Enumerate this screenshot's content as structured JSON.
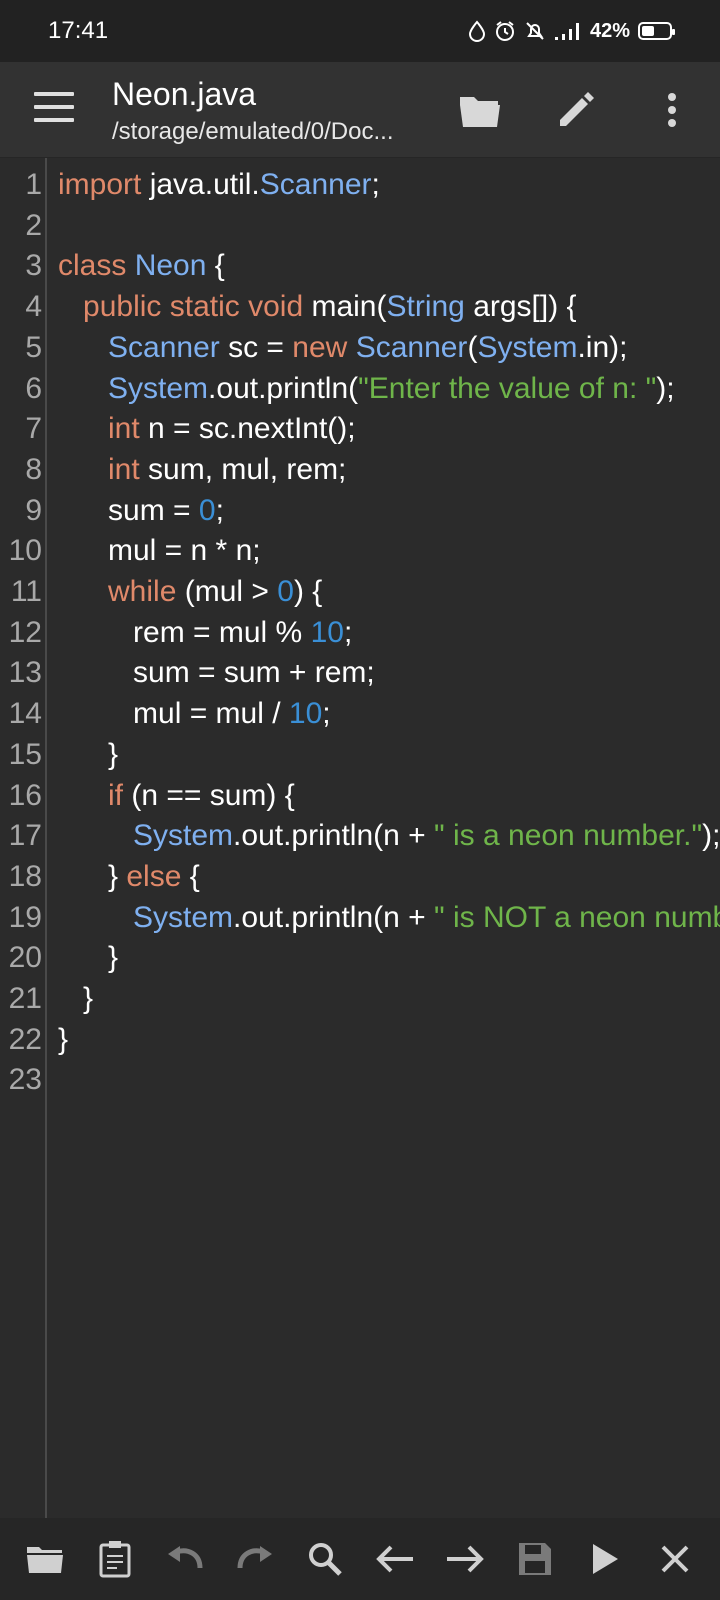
{
  "status_bar": {
    "time": "17:41",
    "battery_percent": "42%",
    "icons": [
      "drop-icon",
      "alarm-icon",
      "notifications-off-icon",
      "signal-icon",
      "battery-icon"
    ]
  },
  "app_bar": {
    "title": "Neon.java",
    "subtitle": "/storage/emulated/0/Doc...",
    "icons": [
      "menu-icon",
      "folder-open-icon",
      "edit-icon",
      "more-vert-icon"
    ]
  },
  "editor": {
    "colors": {
      "keyword": "#e0896a",
      "type": "#7fb0f0",
      "number": "#3a8fd6",
      "string": "#6fb54a",
      "text": "#ffffff"
    },
    "lines": [
      {
        "n": "1",
        "tokens": [
          [
            "kw",
            "import"
          ],
          [
            "tx",
            " java.util."
          ],
          [
            "ty",
            "Scanner"
          ],
          [
            "tx",
            ";"
          ]
        ]
      },
      {
        "n": "2",
        "tokens": []
      },
      {
        "n": "3",
        "tokens": [
          [
            "kw",
            "class"
          ],
          [
            "tx",
            " "
          ],
          [
            "ty",
            "Neon"
          ],
          [
            "tx",
            " {"
          ]
        ]
      },
      {
        "n": "4",
        "tokens": [
          [
            "tx",
            "   "
          ],
          [
            "kw",
            "public static void"
          ],
          [
            "tx",
            " main("
          ],
          [
            "ty",
            "String"
          ],
          [
            "tx",
            " args[]) {"
          ]
        ]
      },
      {
        "n": "5",
        "tokens": [
          [
            "tx",
            "      "
          ],
          [
            "ty",
            "Scanner"
          ],
          [
            "tx",
            " sc = "
          ],
          [
            "kw",
            "new"
          ],
          [
            "tx",
            " "
          ],
          [
            "ty",
            "Scanner"
          ],
          [
            "tx",
            "("
          ],
          [
            "ty",
            "System"
          ],
          [
            "tx",
            ".in);"
          ]
        ]
      },
      {
        "n": "6",
        "tokens": [
          [
            "tx",
            "      "
          ],
          [
            "ty",
            "System"
          ],
          [
            "tx",
            ".out.println("
          ],
          [
            "str",
            "\"Enter the value of n: \""
          ],
          [
            "tx",
            ");"
          ]
        ]
      },
      {
        "n": "7",
        "tokens": [
          [
            "tx",
            "      "
          ],
          [
            "kw",
            "int"
          ],
          [
            "tx",
            " n = sc.nextInt();"
          ]
        ]
      },
      {
        "n": "8",
        "tokens": [
          [
            "tx",
            "      "
          ],
          [
            "kw",
            "int"
          ],
          [
            "tx",
            " sum, mul, rem;"
          ]
        ]
      },
      {
        "n": "9",
        "tokens": [
          [
            "tx",
            "      sum = "
          ],
          [
            "num",
            "0"
          ],
          [
            "tx",
            ";"
          ]
        ]
      },
      {
        "n": "10",
        "tokens": [
          [
            "tx",
            "      mul = n * n;"
          ]
        ]
      },
      {
        "n": "11",
        "tokens": [
          [
            "tx",
            "      "
          ],
          [
            "kw",
            "while"
          ],
          [
            "tx",
            " (mul > "
          ],
          [
            "num",
            "0"
          ],
          [
            "tx",
            ") {"
          ]
        ]
      },
      {
        "n": "12",
        "tokens": [
          [
            "tx",
            "         rem = mul % "
          ],
          [
            "num",
            "10"
          ],
          [
            "tx",
            ";"
          ]
        ]
      },
      {
        "n": "13",
        "tokens": [
          [
            "tx",
            "         sum = sum + rem;"
          ]
        ]
      },
      {
        "n": "14",
        "tokens": [
          [
            "tx",
            "         mul = mul / "
          ],
          [
            "num",
            "10"
          ],
          [
            "tx",
            ";"
          ]
        ]
      },
      {
        "n": "15",
        "tokens": [
          [
            "tx",
            "      }"
          ]
        ]
      },
      {
        "n": "16",
        "tokens": [
          [
            "tx",
            "      "
          ],
          [
            "kw",
            "if"
          ],
          [
            "tx",
            " (n == sum) {"
          ]
        ]
      },
      {
        "n": "17",
        "tokens": [
          [
            "tx",
            "         "
          ],
          [
            "ty",
            "System"
          ],
          [
            "tx",
            ".out.println(n + "
          ],
          [
            "str",
            "\" is a neon number.\""
          ],
          [
            "tx",
            ");"
          ]
        ]
      },
      {
        "n": "18",
        "tokens": [
          [
            "tx",
            "      } "
          ],
          [
            "kw",
            "else"
          ],
          [
            "tx",
            " {"
          ]
        ]
      },
      {
        "n": "19",
        "tokens": [
          [
            "tx",
            "         "
          ],
          [
            "ty",
            "System"
          ],
          [
            "tx",
            ".out.println(n + "
          ],
          [
            "str",
            "\" is NOT a neon number.\""
          ],
          [
            "tx",
            ");"
          ]
        ]
      },
      {
        "n": "20",
        "tokens": [
          [
            "tx",
            "      }"
          ]
        ]
      },
      {
        "n": "21",
        "tokens": [
          [
            "tx",
            "   }"
          ]
        ]
      },
      {
        "n": "22",
        "tokens": [
          [
            "tx",
            "}"
          ]
        ]
      },
      {
        "n": "23",
        "tokens": []
      }
    ]
  },
  "bottom_bar": {
    "icons": [
      "folder-icon",
      "clipboard-icon",
      "undo-icon",
      "redo-icon",
      "search-icon",
      "arrow-left-icon",
      "arrow-right-icon",
      "save-icon",
      "run-icon",
      "close-icon"
    ]
  }
}
